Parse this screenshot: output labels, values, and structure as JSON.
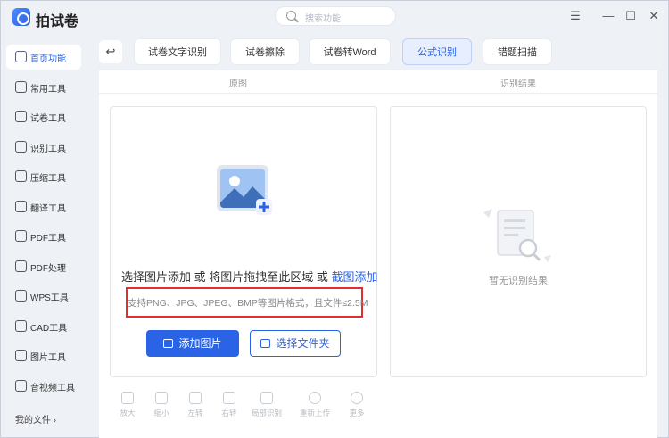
{
  "app": {
    "title": "拍试卷",
    "search_placeholder": "搜索功能"
  },
  "window_controls": {
    "menu": "☰",
    "minimize": "—",
    "maximize": "☐",
    "close": "✕"
  },
  "sidebar": {
    "items": [
      {
        "label": "首页功能",
        "icon": "home-icon",
        "active": true
      },
      {
        "label": "常用工具",
        "icon": "layers-icon"
      },
      {
        "label": "试卷工具",
        "icon": "paper-icon"
      },
      {
        "label": "识别工具",
        "icon": "scan-icon"
      },
      {
        "label": "压缩工具",
        "icon": "compress-icon"
      },
      {
        "label": "翻译工具",
        "icon": "translate-icon"
      },
      {
        "label": "PDF工具",
        "icon": "pdf-icon"
      },
      {
        "label": "PDF处理",
        "icon": "pdf-process-icon"
      },
      {
        "label": "WPS工具",
        "icon": "wps-icon"
      },
      {
        "label": "CAD工具",
        "icon": "cad-icon"
      },
      {
        "label": "图片工具",
        "icon": "image-icon"
      },
      {
        "label": "音视频工具",
        "icon": "media-icon"
      }
    ],
    "my_files": "我的文件 ›"
  },
  "toolbar": {
    "back": "↩",
    "tabs": [
      {
        "label": "试卷文字识别"
      },
      {
        "label": "试卷擦除"
      },
      {
        "label": "试卷转Word"
      },
      {
        "label": "公式识别",
        "active": true
      },
      {
        "label": "错题扫描"
      }
    ]
  },
  "panels": {
    "left_header": "原图",
    "right_header": "识别结果",
    "upload_text_1": "选择图片添加 或 将图片拖拽至此区域 或 ",
    "upload_link": "截图添加",
    "formats": "支持PNG、JPG、JPEG、BMP等图片格式，且文件≤2.5M",
    "add_image": "添加图片",
    "select_folder": "选择文件夹",
    "empty_result": "暂无识别结果"
  },
  "tools": [
    {
      "label": "放大",
      "icon": "zoom-in-icon"
    },
    {
      "label": "缩小",
      "icon": "zoom-out-icon"
    },
    {
      "label": "左转",
      "icon": "rotate-left-icon"
    },
    {
      "label": "右转",
      "icon": "rotate-right-icon"
    },
    {
      "label": "局部识别",
      "icon": "partial-recognize-icon"
    },
    {
      "label": "重新上传",
      "icon": "reupload-icon"
    },
    {
      "label": "更多",
      "icon": "more-icon"
    }
  ],
  "colors": {
    "accent": "#2a63e6",
    "highlight_border": "#e02f2f"
  }
}
